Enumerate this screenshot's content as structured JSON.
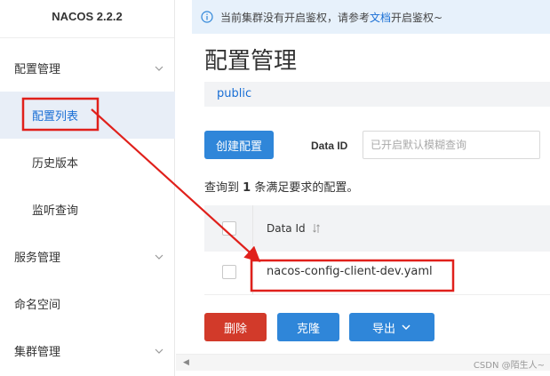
{
  "app": {
    "title": "NACOS 2.2.2"
  },
  "sidebar": {
    "items": [
      {
        "label": "配置管理",
        "expandable": true
      },
      {
        "label": "配置列表",
        "active": true
      },
      {
        "label": "历史版本"
      },
      {
        "label": "监听查询"
      },
      {
        "label": "服务管理",
        "expandable": true
      },
      {
        "label": "命名空间"
      },
      {
        "label": "集群管理",
        "expandable": true
      }
    ]
  },
  "notice": {
    "prefix": "当前集群没有开启鉴权，请参考",
    "link": "文档",
    "suffix": "开启鉴权~",
    "icon": "info-icon"
  },
  "page": {
    "title": "配置管理",
    "namespace": "public"
  },
  "toolbar": {
    "create_label": "创建配置",
    "data_id_label": "Data ID",
    "data_id_placeholder": "已开启默认模糊查询"
  },
  "result": {
    "prefix": "查询到",
    "count": "1",
    "suffix": "条满足要求的配置。"
  },
  "table": {
    "columns": [
      "Data Id"
    ],
    "rows": [
      {
        "data_id": "nacos-config-client-dev.yaml"
      }
    ]
  },
  "actions": {
    "delete_label": "删除",
    "clone_label": "克隆",
    "export_label": "导出"
  },
  "watermark": "CSDN @陌生人~",
  "colors": {
    "primary": "#2f86d9",
    "danger": "#d23a2a",
    "annotation": "#e0201b",
    "link": "#1a6fd5"
  }
}
